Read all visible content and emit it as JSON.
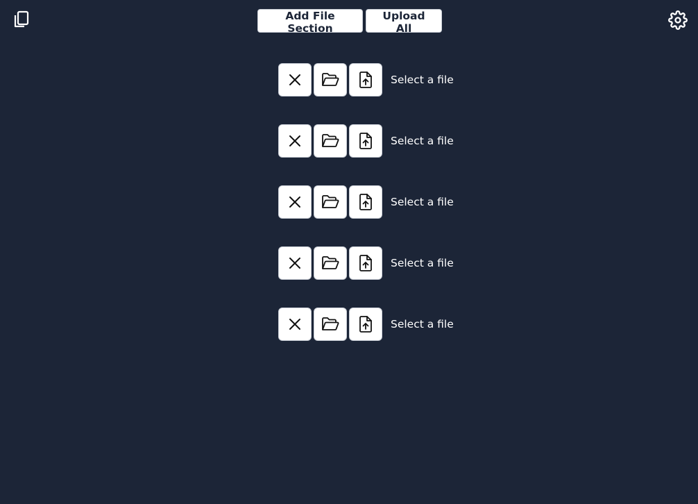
{
  "toolbar": {
    "add_section_label": "Add File Section",
    "upload_all_label": "Upload All"
  },
  "icons": {
    "top_left": "copy-icon",
    "top_right": "gear-icon",
    "remove": "close-icon",
    "browse": "folder-open-icon",
    "upload": "file-upload-icon"
  },
  "colors": {
    "background": "#1c2537",
    "button_bg": "#ffffff",
    "button_text": "#1c2537",
    "label_text": "#ffffff"
  },
  "sections": [
    {
      "label": "Select a file"
    },
    {
      "label": "Select a file"
    },
    {
      "label": "Select a file"
    },
    {
      "label": "Select a file"
    },
    {
      "label": "Select a file"
    }
  ]
}
